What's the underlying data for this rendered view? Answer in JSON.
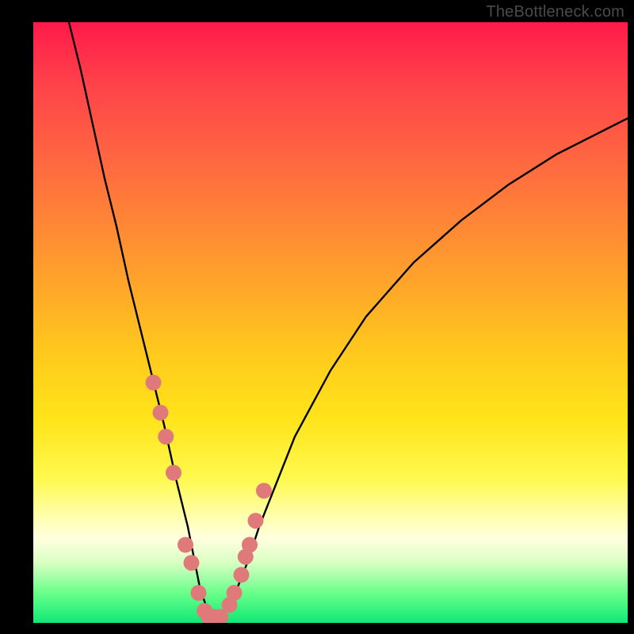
{
  "watermark": "TheBottleneck.com",
  "colors": {
    "background": "#000000",
    "dot": "#e07a7a",
    "curve": "#000000",
    "gradient_top": "#ff1a4a",
    "gradient_bottom": "#10e876"
  },
  "chart_data": {
    "type": "line",
    "title": "",
    "xlabel": "",
    "ylabel": "",
    "xlim": [
      0,
      100
    ],
    "ylim": [
      0,
      100
    ],
    "annotations": [
      "TheBottleneck.com"
    ],
    "series": [
      {
        "name": "bottleneck-curve",
        "x": [
          6,
          8,
          10,
          12,
          14,
          16,
          18,
          20,
          22,
          24,
          25,
          26,
          27,
          28,
          29,
          30,
          31,
          32,
          33,
          34,
          36,
          38,
          40,
          44,
          50,
          56,
          64,
          72,
          80,
          88,
          96,
          100
        ],
        "y": [
          100,
          92,
          83,
          74,
          66,
          57,
          49,
          41,
          33,
          24,
          20,
          16,
          11,
          6,
          3,
          1,
          1,
          1,
          3,
          5,
          10,
          16,
          21,
          31,
          42,
          51,
          60,
          67,
          73,
          78,
          82,
          84
        ]
      },
      {
        "name": "highlight-dots",
        "x": [
          20.2,
          21.4,
          22.3,
          23.6,
          25.6,
          26.6,
          27.8,
          28.8,
          29.5,
          30.4,
          31.5,
          33.0,
          33.8,
          35.0,
          35.7,
          36.4,
          37.4,
          38.8
        ],
        "y": [
          40,
          35,
          31,
          25,
          13,
          10,
          5,
          2,
          1,
          1,
          1,
          3,
          5,
          8,
          11,
          13,
          17,
          22
        ]
      }
    ]
  }
}
